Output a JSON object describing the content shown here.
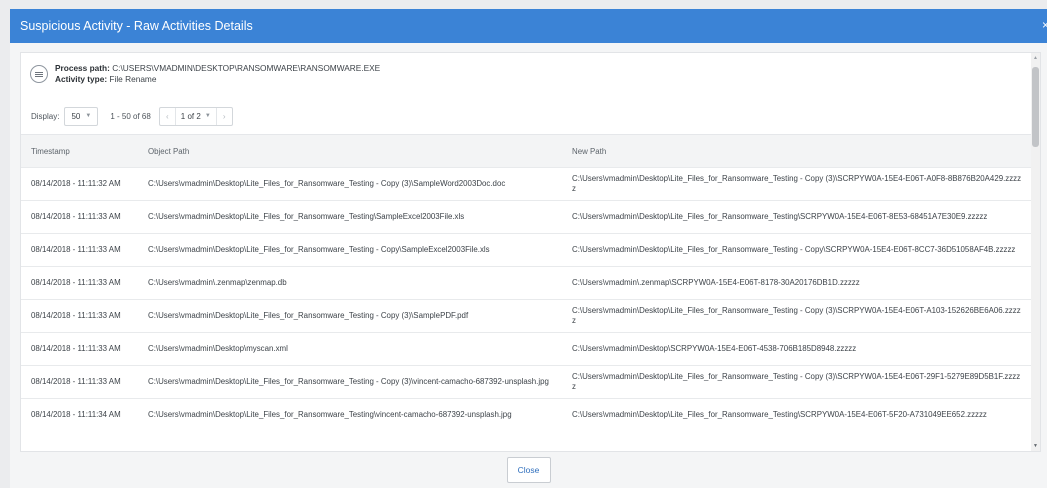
{
  "modal": {
    "title": "Suspicious Activity - Raw Activities Details",
    "close_glyph": "×"
  },
  "info": {
    "process_path_label": "Process path:",
    "process_path_value": "C:\\USERS\\VMADMIN\\DESKTOP\\RANSOMWARE\\RANSOMWARE.EXE",
    "activity_type_label": "Activity type:",
    "activity_type_value": "File Rename"
  },
  "pagination": {
    "display_label": "Display:",
    "page_size": "50",
    "range_text": "1 - 50 of 68",
    "page_text": "1 of 2"
  },
  "table": {
    "headers": [
      "Timestamp",
      "Object Path",
      "New Path"
    ],
    "rows": [
      [
        "08/14/2018 - 11:11:32 AM",
        "C:\\Users\\vmadmin\\Desktop\\Lite_Files_for_Ransomware_Testing - Copy (3)\\SampleWord2003Doc.doc",
        "C:\\Users\\vmadmin\\Desktop\\Lite_Files_for_Ransomware_Testing - Copy (3)\\SCRPYW0A-15E4-E06T-A0F8-8B876B20A429.zzzzz"
      ],
      [
        "08/14/2018 - 11:11:33 AM",
        "C:\\Users\\vmadmin\\Desktop\\Lite_Files_for_Ransomware_Testing\\SampleExcel2003File.xls",
        "C:\\Users\\vmadmin\\Desktop\\Lite_Files_for_Ransomware_Testing\\SCRPYW0A-15E4-E06T-8E53-68451A7E30E9.zzzzz"
      ],
      [
        "08/14/2018 - 11:11:33 AM",
        "C:\\Users\\vmadmin\\Desktop\\Lite_Files_for_Ransomware_Testing - Copy\\SampleExcel2003File.xls",
        "C:\\Users\\vmadmin\\Desktop\\Lite_Files_for_Ransomware_Testing - Copy\\SCRPYW0A-15E4-E06T-8CC7-36D51058AF4B.zzzzz"
      ],
      [
        "08/14/2018 - 11:11:33 AM",
        "C:\\Users\\vmadmin\\.zenmap\\zenmap.db",
        "C:\\Users\\vmadmin\\.zenmap\\SCRPYW0A-15E4-E06T-8178-30A20176DB1D.zzzzz"
      ],
      [
        "08/14/2018 - 11:11:33 AM",
        "C:\\Users\\vmadmin\\Desktop\\Lite_Files_for_Ransomware_Testing - Copy (3)\\SamplePDF.pdf",
        "C:\\Users\\vmadmin\\Desktop\\Lite_Files_for_Ransomware_Testing - Copy (3)\\SCRPYW0A-15E4-E06T-A103-152626BE6A06.zzzzz"
      ],
      [
        "08/14/2018 - 11:11:33 AM",
        "C:\\Users\\vmadmin\\Desktop\\myscan.xml",
        "C:\\Users\\vmadmin\\Desktop\\SCRPYW0A-15E4-E06T-4538-706B185D8948.zzzzz"
      ],
      [
        "08/14/2018 - 11:11:33 AM",
        "C:\\Users\\vmadmin\\Desktop\\Lite_Files_for_Ransomware_Testing - Copy (3)\\vincent-camacho-687392-unsplash.jpg",
        "C:\\Users\\vmadmin\\Desktop\\Lite_Files_for_Ransomware_Testing - Copy (3)\\SCRPYW0A-15E4-E06T-29F1-5279E89D5B1F.zzzzz"
      ],
      [
        "08/14/2018 - 11:11:34 AM",
        "C:\\Users\\vmadmin\\Desktop\\Lite_Files_for_Ransomware_Testing\\vincent-camacho-687392-unsplash.jpg",
        "C:\\Users\\vmadmin\\Desktop\\Lite_Files_for_Ransomware_Testing\\SCRPYW0A-15E4-E06T-5F20-A731049EE652.zzzzz"
      ]
    ]
  },
  "footer": {
    "close_label": "Close"
  },
  "colors": {
    "header_bg": "#3b83d6",
    "link_blue": "#2f6fbd"
  }
}
